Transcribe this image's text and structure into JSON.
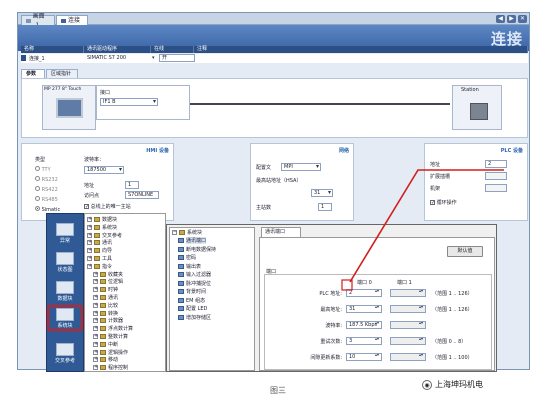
{
  "window": {
    "tabs": [
      {
        "label": "画面_1"
      },
      {
        "label": "连接"
      }
    ],
    "banner_title": "连接"
  },
  "connections_table": {
    "headers": [
      "名称",
      "通讯驱动程序",
      "在线",
      "注释"
    ],
    "row": {
      "name": "连接_1",
      "driver": "SIMATIC S7 200",
      "online": "开",
      "comment": ""
    }
  },
  "param_tabs": [
    {
      "label": "参数"
    },
    {
      "label": "区域指针"
    }
  ],
  "topology": {
    "hmi_name": "MP 277 8\" Touch",
    "interface_label": "接口",
    "interface_value": "IF1 B",
    "station_label": "Station"
  },
  "hmi_settings": {
    "section_title": "HMI 设备",
    "type_label": "类型",
    "types": [
      {
        "label": "TTY"
      },
      {
        "label": "RS232"
      },
      {
        "label": "RS422"
      },
      {
        "label": "RS485"
      },
      {
        "label": "Simatic"
      }
    ],
    "baud_label": "波特率：",
    "baud_value": "187500",
    "address_label": "地址",
    "address_value": "1",
    "access_point_label": "访问点",
    "access_point_value": "S7ONLINE",
    "only_master_label": "总线上的唯一主站"
  },
  "network_settings": {
    "section_title": "网络",
    "profile_label": "配置文",
    "profile_value": "MPI",
    "hsa_label": "最高站地址（HSA）",
    "hsa_value": "31",
    "master_count_label": "主站数",
    "master_count_value": "1"
  },
  "plc_settings": {
    "section_title": "PLC 设备",
    "address_label": "地址",
    "address_value": "2",
    "expansion_label": "扩展插槽",
    "rack_label": "机架",
    "cyclic_label": "循环操作"
  },
  "left_nav": [
    {
      "label": "异常"
    },
    {
      "label": "状态图"
    },
    {
      "label": "数据块"
    },
    {
      "label": "系统块"
    },
    {
      "label": "交叉参考"
    }
  ],
  "project_tree": [
    {
      "label": "数据块",
      "icon": "folder-icon"
    },
    {
      "label": "系统块",
      "icon": "folder-icon"
    },
    {
      "label": "交叉参考",
      "icon": "folder-icon"
    },
    {
      "label": "通讯",
      "icon": "folder-icon"
    },
    {
      "label": "向导",
      "icon": "folder-icon"
    },
    {
      "label": "工具",
      "icon": "folder-icon"
    },
    {
      "label": "指令",
      "icon": "folder-icon"
    },
    {
      "label": "收藏夹",
      "icon": "folder-icon"
    },
    {
      "label": "位逻辑",
      "icon": "folder-icon"
    },
    {
      "label": "时钟",
      "icon": "folder-icon"
    },
    {
      "label": "通讯",
      "icon": "folder-icon"
    },
    {
      "label": "比较",
      "icon": "folder-icon"
    },
    {
      "label": "转换",
      "icon": "folder-icon"
    },
    {
      "label": "计数器",
      "icon": "folder-icon"
    },
    {
      "label": "浮点数计算",
      "icon": "folder-icon"
    },
    {
      "label": "整数计算",
      "icon": "folder-icon"
    },
    {
      "label": "中断",
      "icon": "folder-icon"
    },
    {
      "label": "逻辑操作",
      "icon": "folder-icon"
    },
    {
      "label": "移动",
      "icon": "folder-icon"
    },
    {
      "label": "程序控制",
      "icon": "folder-icon"
    }
  ],
  "system_block": {
    "root_label": "系统块",
    "items": [
      {
        "label": "通讯端口"
      },
      {
        "label": "断电数据保持"
      },
      {
        "label": "密码"
      },
      {
        "label": "输出表"
      },
      {
        "label": "输入过滤器"
      },
      {
        "label": "脉冲捕捉位"
      },
      {
        "label": "背景时间"
      },
      {
        "label": "EM 组态"
      },
      {
        "label": "配置 LED"
      },
      {
        "label": "增加存储区"
      }
    ],
    "tab_label": "通讯端口",
    "default_button": "默认值",
    "port_group_label": "端口",
    "port0_label": "端口 0",
    "port1_label": "端口 1",
    "rows": [
      {
        "label": "PLC 地址:",
        "port0": "2",
        "range": "（范围 1 .. 126）"
      },
      {
        "label": "最高地址:",
        "port0": "31",
        "range": "（范围 1 .. 126）"
      },
      {
        "label": "波特率:",
        "port0": "187.5 Kbps",
        "range": ""
      },
      {
        "label": "重试次数:",
        "port0": "3",
        "range": "（范围 0 .. 8）"
      },
      {
        "label": "间隙更新系数:",
        "port0": "10",
        "range": "（范围 1 .. 100）"
      }
    ]
  },
  "caption": "图三",
  "watermark": "上海坤玛机电",
  "colors": {
    "highlight_red": "#d21e1e",
    "accent_blue": "#2b66b0",
    "banner": "#4a74b4"
  }
}
